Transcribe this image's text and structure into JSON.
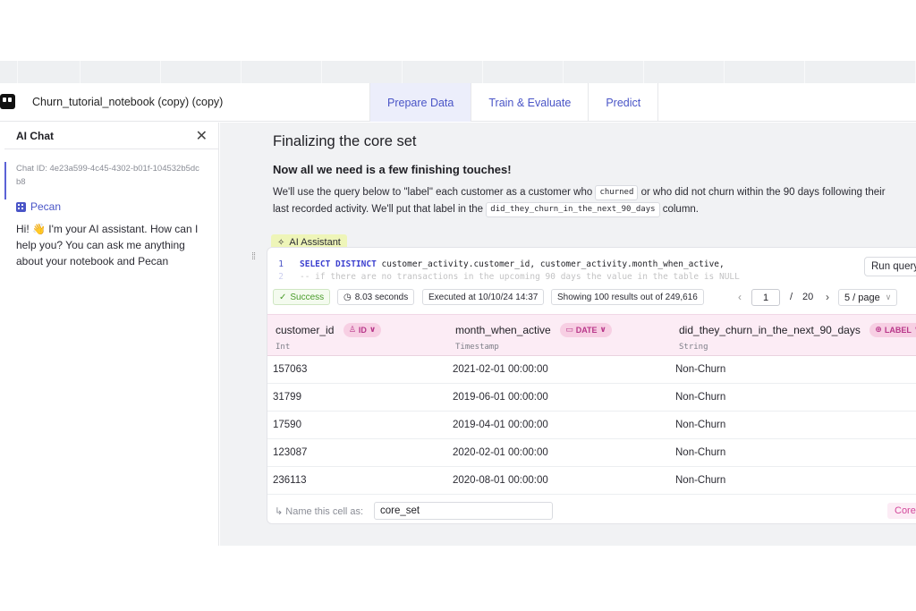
{
  "header": {
    "notebook_title": "Churn_tutorial_notebook (copy) (copy)",
    "tabs": [
      {
        "label": "Prepare Data",
        "active": true
      },
      {
        "label": "Train & Evaluate",
        "active": false
      },
      {
        "label": "Predict",
        "active": false
      }
    ]
  },
  "chat": {
    "title": "AI Chat",
    "close_icon": "close-icon",
    "chat_id": "Chat ID: 4e23a599-4c45-4302-b01f-104532b5dcb8",
    "sender": "Pecan",
    "message": "Hi! 👋 I'm your AI assistant. How can I help you? You can ask me anything about your notebook and Pecan"
  },
  "main": {
    "heading": "Finalizing the core set",
    "subheading": "Now all we need is a few finishing touches!",
    "para_1": "We'll use the query below to \"label\" each customer as a customer who",
    "chip_churned": "churned",
    "para_2": "or who did not churn within the 90 days following their last recorded activity. We'll put that label in the",
    "chip_column": "did_they_churn_in_the_next_90_days",
    "para_3": "column.",
    "ai_assistant_label": "AI Assistant"
  },
  "code": {
    "line1_num": "1",
    "line1_kw": "SELECT DISTINCT",
    "line1_rest": " customer_activity.customer_id, customer_activity.month_when_active,",
    "line2_num": "2",
    "line2_text": "-- if there are no transactions in the upcoming 90 days the value in the table is NULL",
    "run_label": "Run query"
  },
  "status": {
    "success": "Success",
    "duration": "8.03 seconds",
    "executed": "Executed at 10/10/24 14:37",
    "showing": "Showing 100 results out of 249,616",
    "page": "1",
    "page_sep": "/",
    "page_total": "20",
    "page_size": "5 / page"
  },
  "table": {
    "columns": [
      {
        "name": "customer_id",
        "badge": "ID",
        "type": "Int"
      },
      {
        "name": "month_when_active",
        "badge": "DATE",
        "type": "Timestamp"
      },
      {
        "name": "did_they_churn_in_the_next_90_days",
        "badge": "LABEL",
        "type": "String"
      }
    ],
    "rows": [
      [
        "157063",
        "2021-02-01 00:00:00",
        "Non-Churn"
      ],
      [
        "31799",
        "2019-06-01 00:00:00",
        "Non-Churn"
      ],
      [
        "17590",
        "2019-04-01 00:00:00",
        "Non-Churn"
      ],
      [
        "123087",
        "2020-02-01 00:00:00",
        "Non-Churn"
      ],
      [
        "236113",
        "2020-08-01 00:00:00",
        "Non-Churn"
      ]
    ]
  },
  "footer": {
    "name_label": "↳ Name this cell as:",
    "name_value": "core_set",
    "tag": "Core"
  },
  "colors": {
    "accent": "#4a55c7",
    "label_badge": "#b8378a",
    "success": "#4a9c2a",
    "ai_chip": "#eef5b8"
  }
}
